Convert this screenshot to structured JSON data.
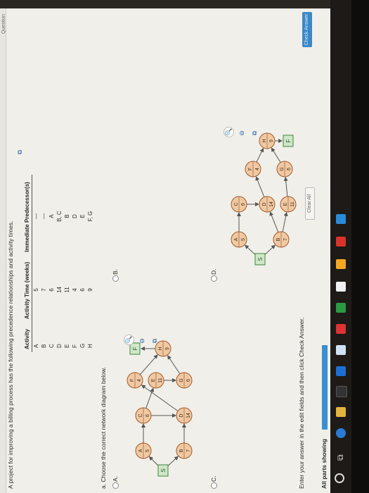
{
  "header": {
    "question_label": "Question"
  },
  "title": "A project for improving a billing process has the following precedence relationships and activity times.",
  "table": {
    "headers": [
      "Activity",
      "Activity Time (weeks)",
      "Immediate Predecessor(s)"
    ],
    "rows": [
      [
        "A",
        "5",
        "—"
      ],
      [
        "B",
        "7",
        "—"
      ],
      [
        "C",
        "6",
        "A"
      ],
      [
        "D",
        "14",
        "B, C"
      ],
      [
        "E",
        "11",
        "B"
      ],
      [
        "F",
        "4",
        "D"
      ],
      [
        "G",
        "6",
        "E"
      ],
      [
        "H",
        "9",
        "F, G"
      ]
    ]
  },
  "part_a": {
    "prompt": "a. Choose the correct network diagram below."
  },
  "options": [
    {
      "label": "A."
    },
    {
      "label": "B."
    },
    {
      "label": "C."
    },
    {
      "label": "D."
    }
  ],
  "nodes": {
    "S": "S",
    "F_end": "F",
    "A": {
      "name": "A",
      "time": "5"
    },
    "B": {
      "name": "B",
      "time": "7"
    },
    "C": {
      "name": "C",
      "time": "6"
    },
    "D": {
      "name": "D",
      "time": "14"
    },
    "E": {
      "name": "E",
      "time": "11"
    },
    "F": {
      "name": "F",
      "time": "4"
    },
    "G": {
      "name": "G",
      "time": "6"
    },
    "H": {
      "name": "H",
      "time": "9"
    }
  },
  "footer": {
    "instruction": "Enter your answer in the edit fields and then click Check Answer.",
    "parts": "All parts showing",
    "clear_all": "Clear All",
    "check_answer": "Check Answer"
  },
  "colors": {
    "node_fill": "#f0c9a3",
    "node_stroke": "#a05a2c",
    "term_fill": "#cfe6c8",
    "term_stroke": "#3b8a3b",
    "accent": "#3b88c8"
  }
}
